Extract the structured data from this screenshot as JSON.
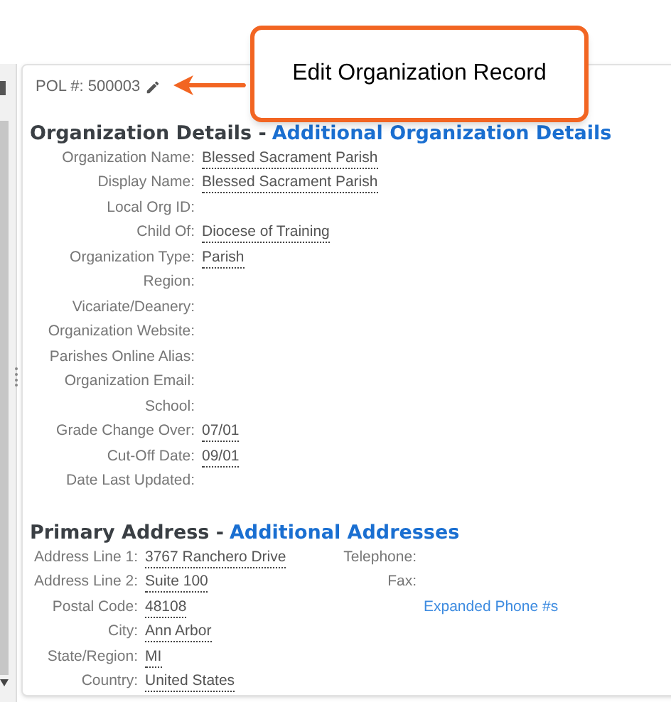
{
  "pol": {
    "label": "POL #:",
    "value": "500003"
  },
  "callout": {
    "text": "Edit Organization Record"
  },
  "org_details": {
    "title": "Organization Details -",
    "link": "Additional Organization Details",
    "fields": [
      {
        "label": "Organization Name:",
        "value": "Blessed Sacrament Parish"
      },
      {
        "label": "Display Name:",
        "value": "Blessed Sacrament Parish"
      },
      {
        "label": "Local Org ID:"
      },
      {
        "label": "Child Of:",
        "value": "Diocese of Training"
      },
      {
        "label": "Organization Type:",
        "value": "Parish"
      },
      {
        "label": "Region:"
      },
      {
        "label": "Vicariate/Deanery:"
      },
      {
        "label": "Organization Website:"
      },
      {
        "label": "Parishes Online Alias:"
      },
      {
        "label": "Organization Email:"
      },
      {
        "label": "School:"
      },
      {
        "label": "Grade Change Over:",
        "value": "07/01"
      },
      {
        "label": "Cut-Off Date:",
        "value": "09/01"
      },
      {
        "label": "Date Last Updated:"
      }
    ]
  },
  "primary_address": {
    "title": "Primary Address -",
    "link": "Additional Addresses",
    "fields": [
      {
        "label": "Address Line 1:",
        "value": "3767 Ranchero Drive"
      },
      {
        "label": "Address Line 2:",
        "value": "Suite 100"
      },
      {
        "label": "Postal Code:",
        "value": "48108"
      },
      {
        "label": "City:",
        "value": "Ann Arbor"
      },
      {
        "label": "State/Region:",
        "value": "MI"
      },
      {
        "label": "Country:",
        "value": "United States"
      }
    ],
    "phone_fields": [
      {
        "label": "Telephone:"
      },
      {
        "label": "Fax:"
      }
    ],
    "phone_link": "Expanded Phone #s"
  }
}
